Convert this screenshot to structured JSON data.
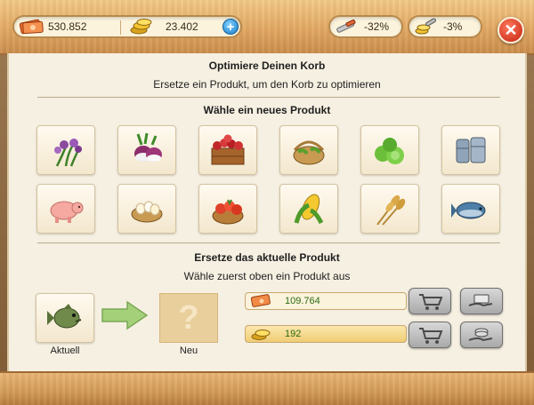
{
  "topbar": {
    "money": {
      "icon": "banknotes-icon",
      "value": "530.852"
    },
    "coins": {
      "icon": "gold-coins-icon",
      "value": "23.402"
    },
    "add_icon": "plus-icon",
    "boost_a": {
      "icon": "pipe-tool-icon",
      "value": "-32%"
    },
    "boost_b": {
      "icon": "wrench-coins-icon",
      "value": "-3%"
    },
    "close_icon": "close-icon"
  },
  "dialog": {
    "title": "Optimiere Deinen Korb",
    "subtitle": "Ersetze ein Produkt, um den Korb zu optimieren",
    "choose_heading": "Wähle ein neues Produkt",
    "products": [
      {
        "icon": "lavender-flowers-icon"
      },
      {
        "icon": "turnips-icon"
      },
      {
        "icon": "berries-crate-icon"
      },
      {
        "icon": "beans-basket-icon"
      },
      {
        "icon": "cabbage-icon"
      },
      {
        "icon": "metal-barrels-icon"
      },
      {
        "icon": "pig-icon"
      },
      {
        "icon": "eggs-basket-icon"
      },
      {
        "icon": "tomato-basket-icon"
      },
      {
        "icon": "corn-icon"
      },
      {
        "icon": "wheat-icon"
      },
      {
        "icon": "tuna-fish-icon"
      }
    ],
    "replace_heading": "Ersetze das aktuelle Produkt",
    "replace_hint": "Wähle zuerst oben ein Produkt aus",
    "current_label": "Aktuell",
    "current_icon": "bass-fish-icon",
    "new_label": "Neu",
    "new_placeholder": "?",
    "arrow_icon": "arrow-right-icon",
    "cost_money": {
      "icon": "banknotes-icon",
      "value": "109.764"
    },
    "cost_coins": {
      "icon": "gold-coins-icon",
      "value": "192"
    },
    "buy_icon": "shopping-cart-icon",
    "sell_icon": "coins-hand-icon"
  },
  "colors": {
    "wood": "#e2a862",
    "panel": "#f6f0e2",
    "close_red": "#c2200e",
    "value_green": "#2d6a12",
    "coin_bar": "#f7d98c"
  }
}
